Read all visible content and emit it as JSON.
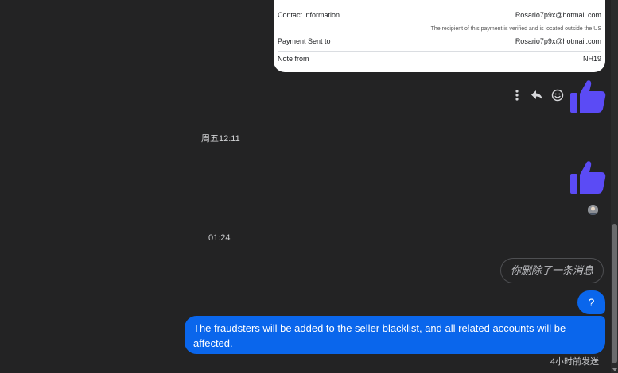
{
  "payment_card": {
    "rows": [
      {
        "label": "Contact information",
        "value": "Rosario7p9x@hotmail.com"
      },
      {
        "label": "Payment Sent to",
        "value": "Rosario7p9x@hotmail.com"
      },
      {
        "label": "Note from",
        "value": "NH19"
      }
    ],
    "verification_note": "The recipient of this payment is verified and is located outside the US"
  },
  "timestamps": {
    "first": "周五12:11",
    "second": "01:24"
  },
  "deleted_message": "你删除了一条消息",
  "messages": {
    "question": "?",
    "fraud_notice": "The fraudsters will be added to the seller blacklist, and all related accounts will be affected."
  },
  "sent_status": "4小时前发送",
  "colors": {
    "background": "#232324",
    "bubble_blue": "#0a66ec",
    "thumbs_up": "#5b4bf5"
  },
  "icons": [
    "more-options-icon",
    "reply-icon",
    "emoji-icon",
    "thumbs-up-icon",
    "seen-avatar"
  ]
}
